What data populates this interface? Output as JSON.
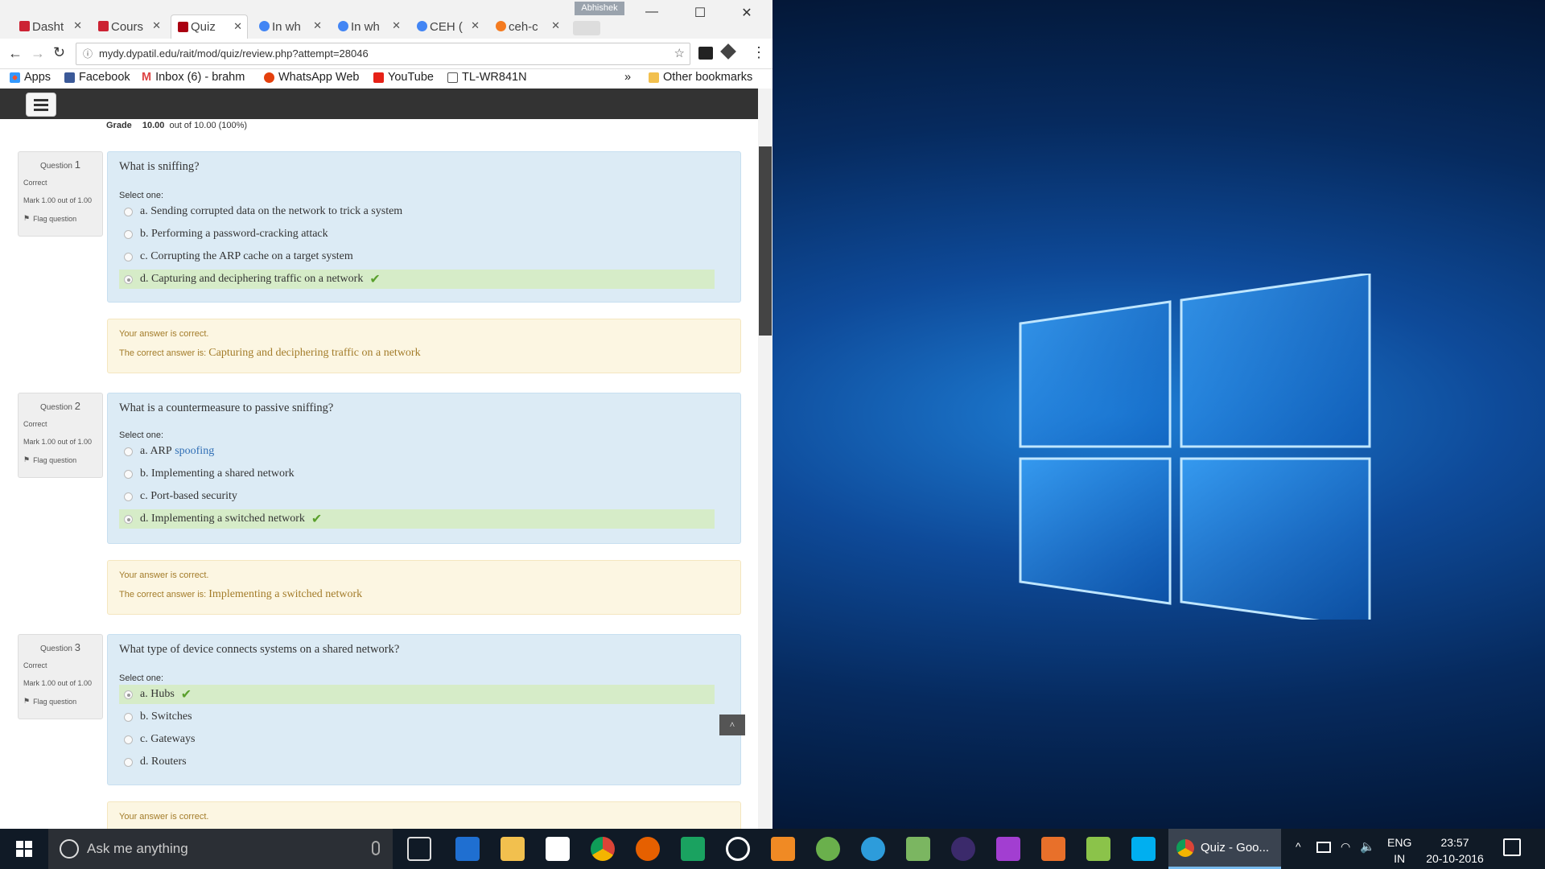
{
  "browser": {
    "tabs": [
      {
        "label": "Dasht",
        "icon": "moodle-shield-icon",
        "active": false
      },
      {
        "label": "Cours",
        "icon": "moodle-shield-icon",
        "active": false
      },
      {
        "label": "Quiz",
        "icon": "moodle-shield-icon",
        "active": true
      },
      {
        "label": "In wh",
        "icon": "google-icon",
        "active": false
      },
      {
        "label": "In wh",
        "icon": "google-icon",
        "active": false
      },
      {
        "label": "CEH (",
        "icon": "google-icon",
        "active": false
      },
      {
        "label": "ceh-c",
        "icon": "pdf-icon",
        "active": false
      }
    ],
    "profile_name": "Abhishek",
    "url": "mydy.dypatil.edu/rait/mod/quiz/review.php?attempt=28046",
    "bookmarks": [
      {
        "label": "Apps",
        "icon": "apps-grid-icon"
      },
      {
        "label": "Facebook",
        "icon": "facebook-icon"
      },
      {
        "label": "Inbox (6) - brahm",
        "icon": "gmail-icon"
      },
      {
        "label": "WhatsApp Web",
        "icon": "whatsapp-icon"
      },
      {
        "label": "YouTube",
        "icon": "youtube-icon"
      },
      {
        "label": "TL-WR841N",
        "icon": "page-icon"
      }
    ],
    "bookmarks_overflow": "»",
    "other_bookmarks": "Other bookmarks"
  },
  "quiz": {
    "grade_label": "Grade",
    "grade_value": "10.00",
    "grade_suffix": "out of 10.00 (100%)",
    "questions": [
      {
        "prefix": "Question",
        "number": "1",
        "state": "Correct",
        "mark": "Mark 1.00 out of 1.00",
        "flag": "Flag question",
        "text": "What is sniffing?",
        "prompt": "Select one:",
        "options": [
          "a. Sending corrupted data on the network to trick a system",
          "b. Performing a password-cracking attack",
          "c. Corrupting the ARP cache on a target system",
          "d. Capturing and deciphering traffic on a network"
        ],
        "selected_index": 3,
        "feedback": "Your answer is correct.",
        "right_label": "The correct answer is:",
        "right_answer": "Capturing and deciphering traffic on a network"
      },
      {
        "prefix": "Question",
        "number": "2",
        "state": "Correct",
        "mark": "Mark 1.00 out of 1.00",
        "flag": "Flag question",
        "text": "What is a countermeasure to passive sniffing?",
        "prompt": "Select one:",
        "options_a_prefix": "a. ARP",
        "options_a_link": "spoofing",
        "options": [
          "a. ARP spoofing",
          "b. Implementing a shared network",
          "c. Port-based security",
          "d. Implementing a switched network"
        ],
        "selected_index": 3,
        "feedback": "Your answer is correct.",
        "right_label": "The correct answer is:",
        "right_answer": "Implementing a switched network"
      },
      {
        "prefix": "Question",
        "number": "3",
        "state": "Correct",
        "mark": "Mark 1.00 out of 1.00",
        "flag": "Flag question",
        "text": "What type of device connects systems on a shared network?",
        "prompt": "Select one:",
        "options": [
          "a. Hubs",
          "b. Switches",
          "c. Gateways",
          "d. Routers"
        ],
        "selected_index": 0,
        "feedback": "Your answer is correct."
      }
    ],
    "back_to_top": "^"
  },
  "taskbar": {
    "search_placeholder": "Ask me anything",
    "active_window": "Quiz - Goo...",
    "pinned_icons": [
      "task-view-icon",
      "edge-icon",
      "file-explorer-icon",
      "store-icon",
      "chrome-icon",
      "firefox-icon",
      "vivaldi-icon",
      "media-player-icon",
      "video-icon",
      "utorrent-icon",
      "network-globe-icon",
      "notepad-icon",
      "eclipse-icon",
      "phpstorm-icon",
      "matlab-icon",
      "bluestacks-icon",
      "skype-icon"
    ],
    "lang_line1": "ENG",
    "lang_line2": "IN",
    "time": "23:57",
    "date": "20-10-2016"
  },
  "colors": {
    "formulation_bg": "#dcebf5",
    "outcome_bg": "#fcf6e2",
    "selected_option_bg": "#d6ecc8",
    "check_green": "#5aa02c",
    "moodle_bar": "#333333",
    "taskbar_bg": "#101a26"
  }
}
